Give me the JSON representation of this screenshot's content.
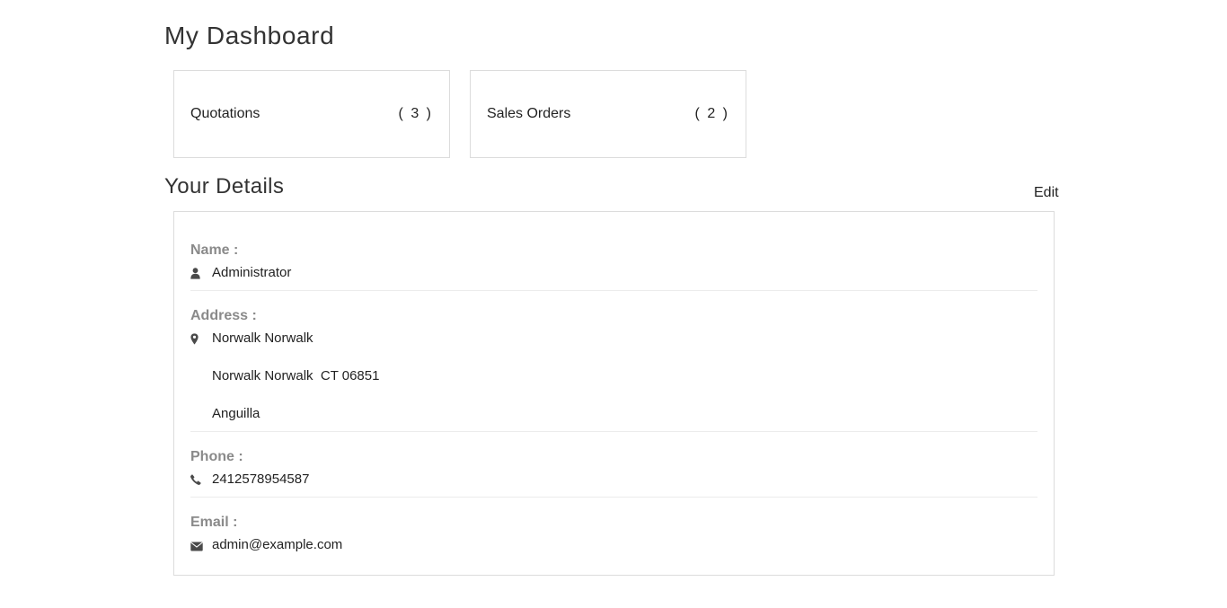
{
  "page": {
    "title": "My Dashboard"
  },
  "cards": {
    "quotations": {
      "label": "Quotations",
      "count": "( 3 )"
    },
    "sales_orders": {
      "label": "Sales Orders",
      "count": "( 2 )"
    }
  },
  "details": {
    "title": "Your Details",
    "edit_label": "Edit",
    "name": {
      "label": "Name :",
      "value": "Administrator",
      "icon": "user-icon"
    },
    "address": {
      "label": "Address :",
      "line1": "Norwalk Norwalk",
      "line2": "Norwalk Norwalk  CT 06851",
      "line3": "Anguilla",
      "icon": "map-marker-icon"
    },
    "phone": {
      "label": "Phone :",
      "value": "2412578954587",
      "icon": "phone-icon"
    },
    "email": {
      "label": "Email :",
      "value": "admin@example.com",
      "icon": "envelope-icon"
    }
  },
  "colors": {
    "label_gray": "#8a8a8a",
    "border": "#dcdcdc",
    "text": "#1f1f1f"
  }
}
